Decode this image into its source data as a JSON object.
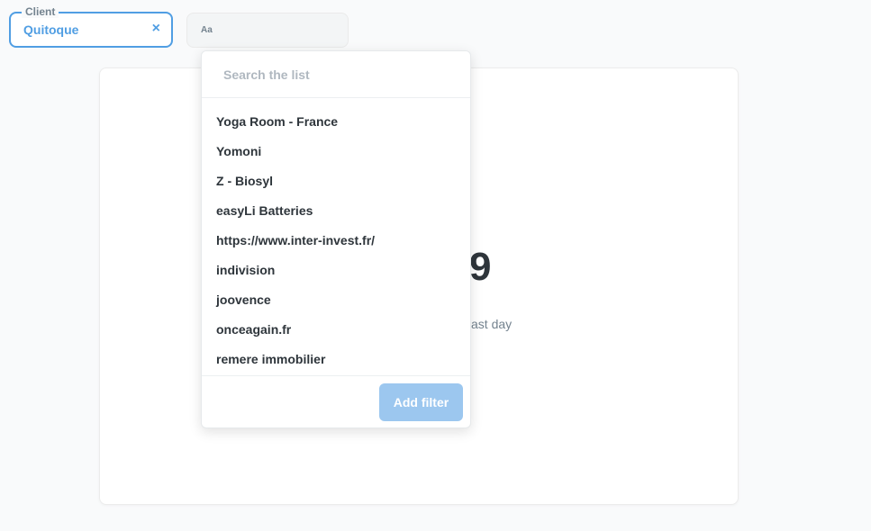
{
  "filters": {
    "client": {
      "label": "Client",
      "value": "Quitoque",
      "clear_icon": "×"
    },
    "text_filter": {
      "icon_text": "Aa"
    }
  },
  "card": {
    "value": "9",
    "subtitle": "ast day"
  },
  "dropdown": {
    "search_placeholder": "Search the list",
    "options": [
      "Yoga Room - France",
      "Yomoni",
      "Z - Biosyl",
      "easyLi Batteries",
      "https://www.inter-invest.fr/",
      "indivision",
      "joovence",
      "onceagain.fr",
      "remere immobilier"
    ],
    "add_filter_label": "Add filter"
  },
  "colors": {
    "accent": "#509ee3",
    "button_disabled": "#9cc7ef",
    "text": "#2e353b",
    "muted": "#74838f"
  }
}
